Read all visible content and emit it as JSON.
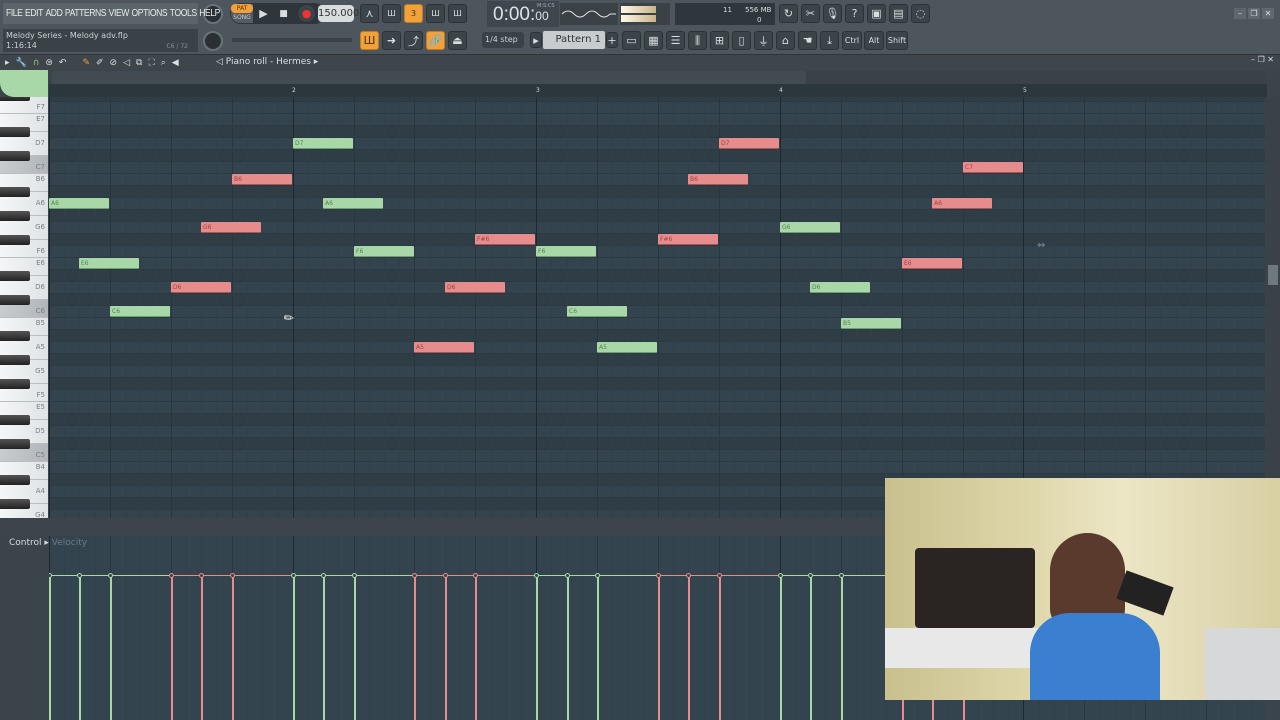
{
  "menu": [
    "FILE",
    "EDIT",
    "ADD",
    "PATTERNS",
    "VIEW",
    "OPTIONS",
    "TOOLS",
    "HELP"
  ],
  "project": {
    "title": "Melody Series - Melody adv.flp",
    "position": "1:16:14",
    "hint_note": "C6 / 72"
  },
  "transport": {
    "pat_label": "PAT",
    "song_label": "SONG",
    "tempo": "150.000",
    "time": "0:00",
    "time_sub": "00",
    "time_unit": "M:S:CS"
  },
  "monitor": {
    "voices": "11",
    "memory": "556 MB",
    "cpu": "0"
  },
  "snap": "1/4 step",
  "pattern": "Pattern 1",
  "modifier_keys": [
    "Ctrl",
    "Alt",
    "Shift"
  ],
  "piano_roll": {
    "title": "Piano roll - Hermes",
    "bar_labels": [
      "2",
      "3",
      "4",
      "5"
    ],
    "key_labels": [
      "F7",
      "E7",
      "D7",
      "C7",
      "B6",
      "A6",
      "G6",
      "F6",
      "E6",
      "D6",
      "C6",
      "B5",
      "A5",
      "G5",
      "F5",
      "E5",
      "D5",
      "C5",
      "B4",
      "A4",
      "G4"
    ],
    "colors": {
      "green": "#a8d8a8",
      "red": "#e68c8c",
      "grid": "#34444e"
    },
    "notes": [
      {
        "pitch": "A6",
        "beat": 0,
        "len": 1,
        "color": "g"
      },
      {
        "pitch": "E6",
        "beat": 0.5,
        "len": 1,
        "color": "g"
      },
      {
        "pitch": "C6",
        "beat": 1,
        "len": 1,
        "color": "g"
      },
      {
        "pitch": "D6",
        "beat": 2,
        "len": 1,
        "color": "r"
      },
      {
        "pitch": "G6",
        "beat": 2.5,
        "len": 1,
        "color": "r"
      },
      {
        "pitch": "B6",
        "beat": 3,
        "len": 1,
        "color": "r"
      },
      {
        "pitch": "D7",
        "beat": 4,
        "len": 1,
        "color": "g"
      },
      {
        "pitch": "A6",
        "beat": 4.5,
        "len": 1,
        "color": "g"
      },
      {
        "pitch": "F6",
        "beat": 5,
        "len": 1,
        "color": "g"
      },
      {
        "pitch": "A5",
        "beat": 6,
        "len": 1,
        "color": "r"
      },
      {
        "pitch": "D6",
        "beat": 6.5,
        "len": 1,
        "color": "r"
      },
      {
        "pitch": "F#6",
        "beat": 7,
        "len": 1,
        "color": "r"
      },
      {
        "pitch": "F6",
        "beat": 8,
        "len": 1,
        "color": "g"
      },
      {
        "pitch": "C6",
        "beat": 8.5,
        "len": 1,
        "color": "g"
      },
      {
        "pitch": "A5",
        "beat": 9,
        "len": 1,
        "color": "g"
      },
      {
        "pitch": "F#6",
        "beat": 10,
        "len": 1,
        "color": "r"
      },
      {
        "pitch": "B6",
        "beat": 10.5,
        "len": 1,
        "color": "r"
      },
      {
        "pitch": "D7",
        "beat": 11,
        "len": 1,
        "color": "r"
      },
      {
        "pitch": "G6",
        "beat": 12,
        "len": 1,
        "color": "g"
      },
      {
        "pitch": "D6",
        "beat": 12.5,
        "len": 1,
        "color": "g"
      },
      {
        "pitch": "B5",
        "beat": 13,
        "len": 1,
        "color": "g"
      },
      {
        "pitch": "E6",
        "beat": 14,
        "len": 1,
        "color": "r"
      },
      {
        "pitch": "A6",
        "beat": 14.5,
        "len": 1,
        "color": "r"
      },
      {
        "pitch": "C7",
        "beat": 15,
        "len": 1,
        "color": "r"
      }
    ],
    "velocity_level": 0.78
  },
  "control": {
    "label": "Control",
    "target": "Velocity"
  }
}
